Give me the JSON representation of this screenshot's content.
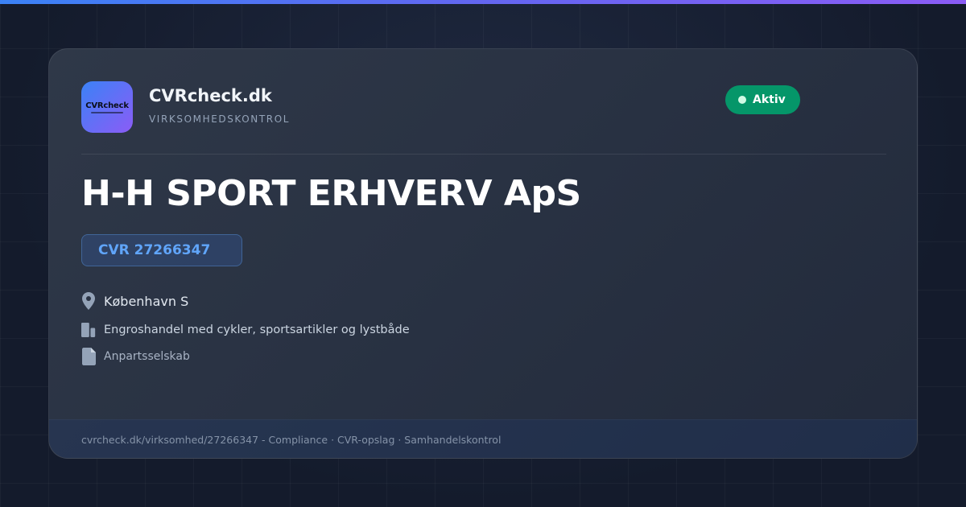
{
  "brand": {
    "logo_text": "CVRcheck",
    "name": "CVRcheck.dk",
    "tagline": "VIRKSOMHEDSKONTROL"
  },
  "status": {
    "label": "Aktiv",
    "color": "#059669"
  },
  "company": {
    "name": "H-H SPORT ERHVERV ApS",
    "cvr": "CVR 27266347",
    "location": "København S",
    "industry": "Engroshandel med cykler, sportsartikler og lystbåde",
    "company_type": "Anpartsselskab"
  },
  "icons": {
    "location": "map-pin-icon",
    "industry": "building-icon",
    "company_type": "document-icon"
  },
  "footer": {
    "text": "cvrcheck.dk/virksomhed/27266347 - Compliance · CVR-opslag · Samhandelskontrol"
  },
  "colors": {
    "accent_start": "#3b82f6",
    "accent_end": "#8b5cf6",
    "cvr_text": "#60a5fa"
  }
}
